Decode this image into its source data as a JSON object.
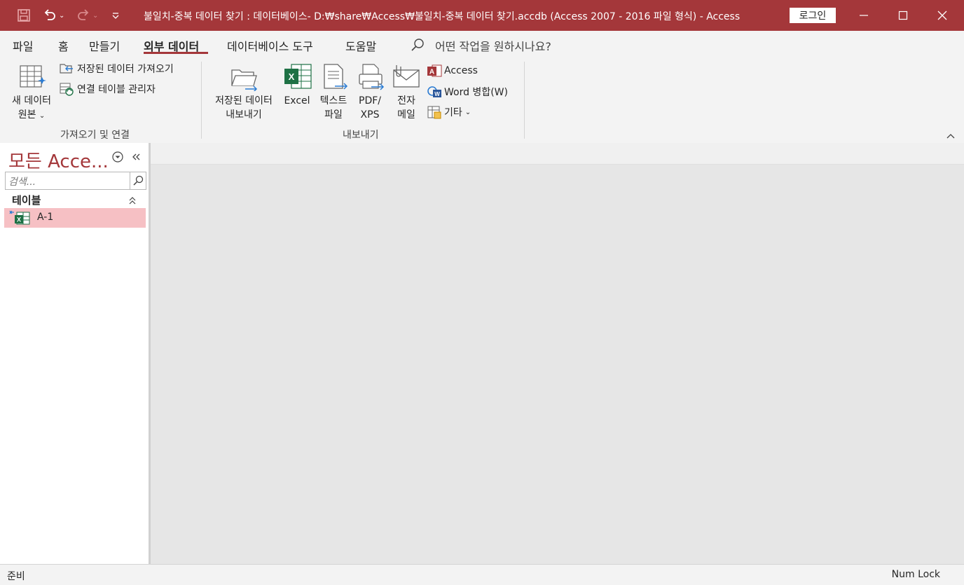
{
  "title_bar": {
    "title": "불일치-중복 데이터 찾기 : 데이터베이스- D:₩share₩Access₩불일치-중복 데이터 찾기.accdb (Access 2007 - 2016 파일 형식)  -  Access",
    "login": "로그인"
  },
  "menu": {
    "items": [
      "파일",
      "홈",
      "만들기",
      "외부 데이터",
      "데이터베이스 도구",
      "도움말"
    ],
    "active": "외부 데이터",
    "tell_me": "어떤 작업을 원하시나요?"
  },
  "ribbon": {
    "import_group": {
      "label": "가져오기 및 연결",
      "new_source_line1": "새 데이터",
      "new_source_line2": "원본",
      "saved_imports": "저장된 데이터 가져오기",
      "linked_table_manager": "연결 테이블 관리자"
    },
    "export_group": {
      "label": "내보내기",
      "saved_exports_line1": "저장된 데이터",
      "saved_exports_line2": "내보내기",
      "excel": "Excel",
      "text_line1": "텍스트",
      "text_line2": "파일",
      "pdf_line1": "PDF/",
      "pdf_line2": "XPS",
      "email_line1": "전자",
      "email_line2": "메일",
      "access": "Access",
      "word_merge": "Word 병합(W)",
      "more": "기타"
    }
  },
  "nav_pane": {
    "title": "모든 Acce...",
    "search_placeholder": "검색...",
    "section": "테이블",
    "items": [
      {
        "label": "A-1"
      }
    ]
  },
  "status_bar": {
    "left": "준비",
    "right": "Num Lock"
  },
  "colors": {
    "accent": "#a4373a",
    "selected_item": "#f6c0c4",
    "excel_green": "#1e7145",
    "link_blue": "#2b7cd3"
  }
}
